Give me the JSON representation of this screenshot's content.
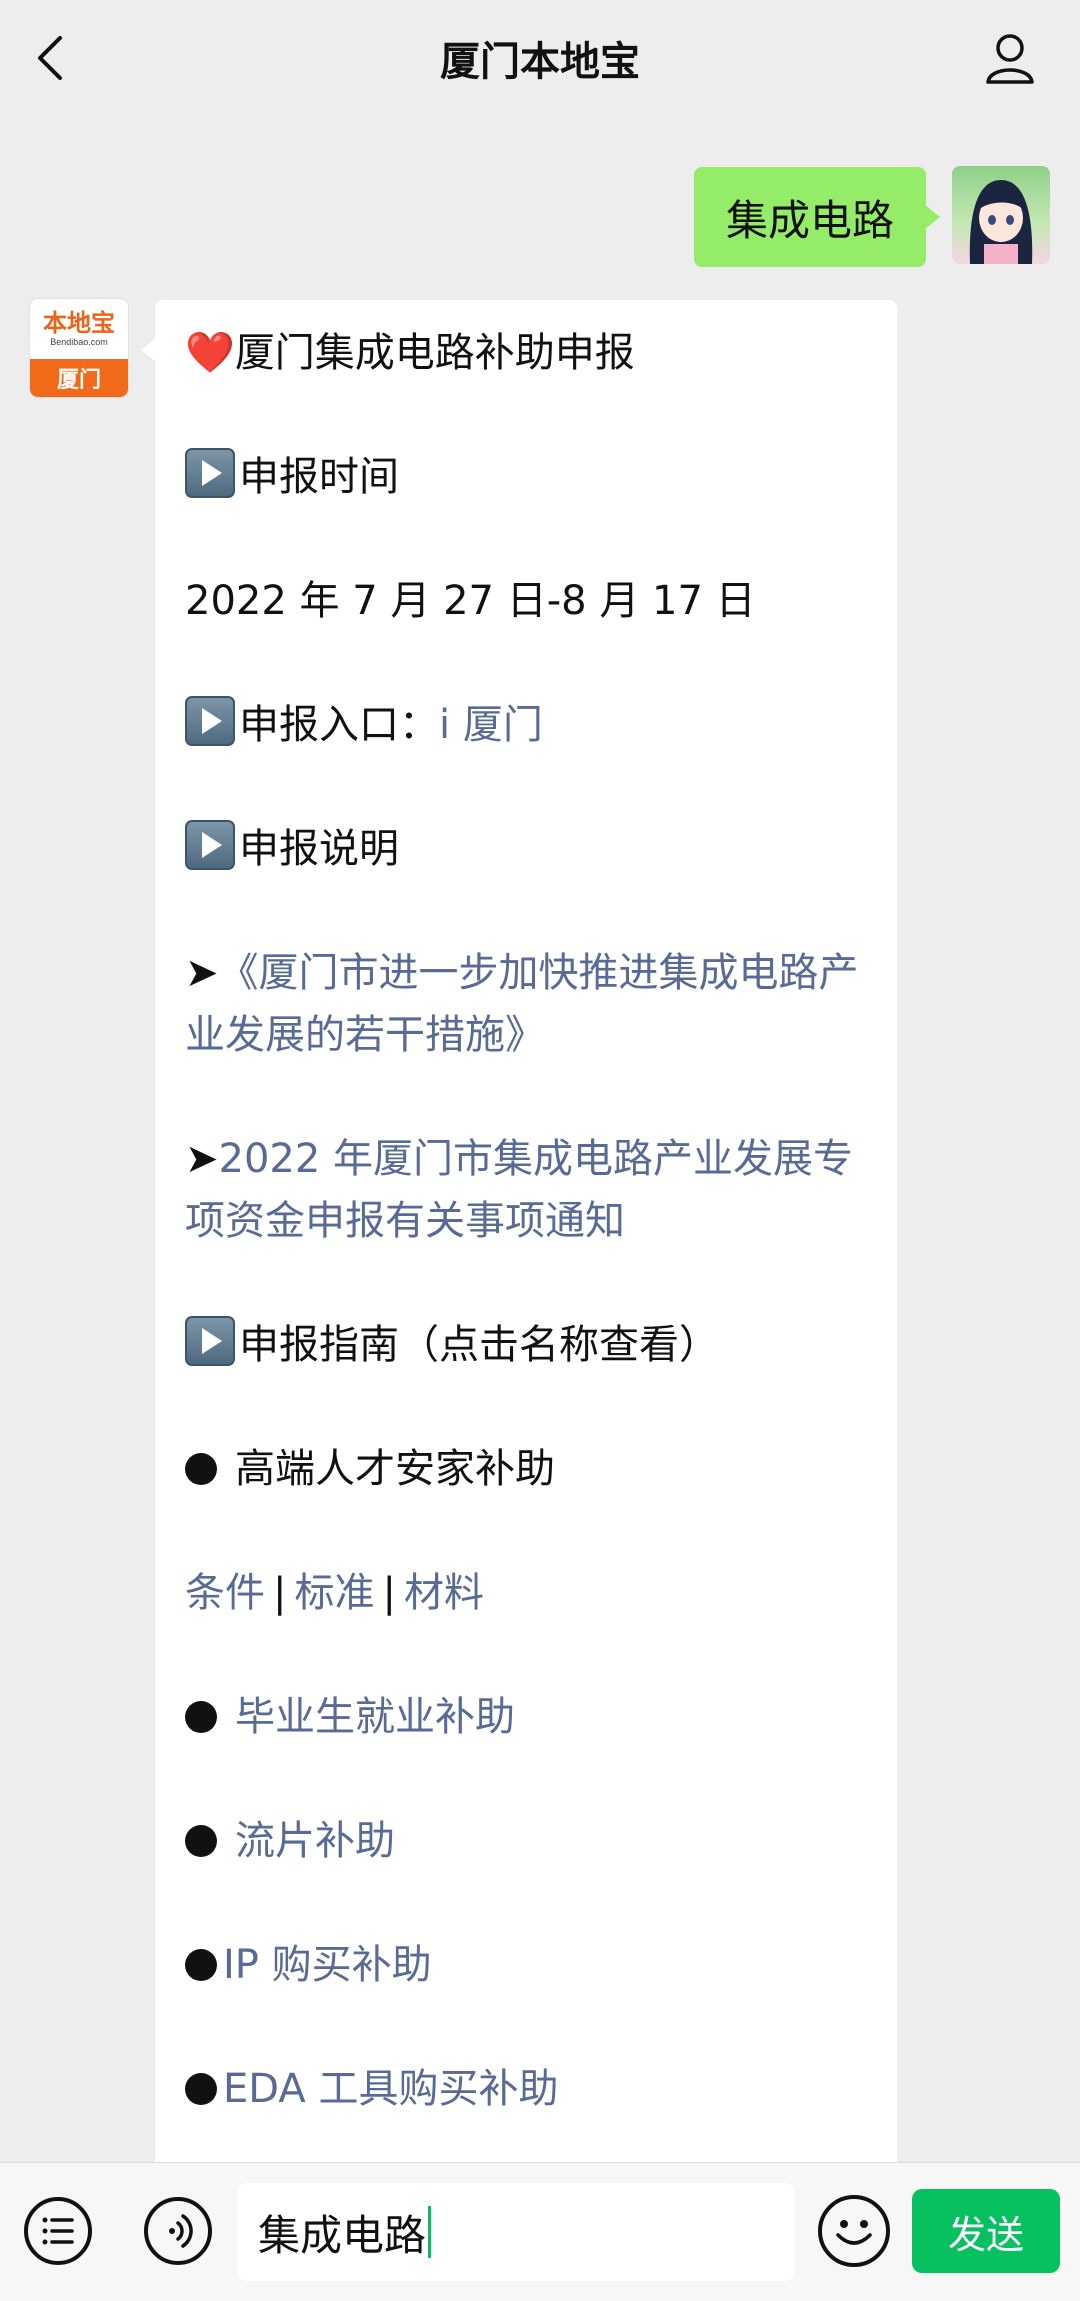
{
  "header": {
    "title": "厦门本地宝"
  },
  "outgoing_message": {
    "text": "集成电路"
  },
  "bot": {
    "logo_main": "本地宝",
    "logo_sub": "Bendibao.com",
    "logo_city": "厦门"
  },
  "article": {
    "title": "厦门集成电路补助申报",
    "time_heading": "申报时间",
    "time_value": "2022 年 7 月 27 日-8 月 17 日",
    "entry_heading": "申报入口：",
    "entry_link": "i 厦门",
    "desc_heading": "申报说明",
    "doc1_arrow": "➤",
    "doc1": "《厦门市进一步加快推进集成电路产业发展的若干措施》",
    "doc2_arrow": "➤",
    "doc2": "2022 年厦门市集成电路产业发展专项资金申报有关事项通知",
    "guide_heading": "申报指南（点击名称查看）",
    "item1": "高端人才安家补助",
    "item1_links": [
      "条件",
      "标准",
      "材料"
    ],
    "separator": "|",
    "item2": "毕业生就业补助",
    "item3": "流片补助",
    "item4": "IP 购买补助",
    "item5": "EDA 工具购买补助"
  },
  "input_bar": {
    "text": "集成电路",
    "send_label": "发送"
  },
  "colors": {
    "link": "#576b95",
    "outgoing_bubble": "#95ec69",
    "send_button": "#07c160",
    "brand_orange": "#f06a1a"
  }
}
